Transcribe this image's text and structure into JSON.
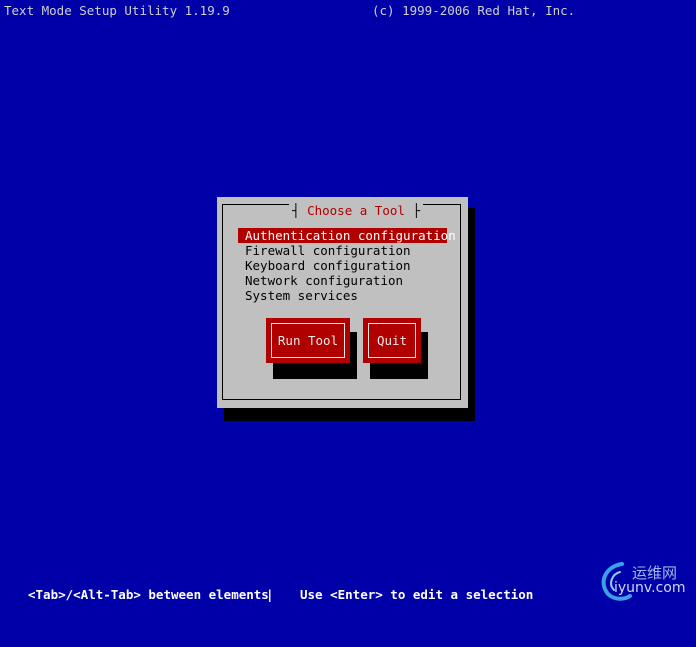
{
  "header": {
    "app_title": "Text Mode Setup Utility 1.19.9",
    "copyright": "(c) 1999-2006 Red Hat, Inc."
  },
  "dialog": {
    "title": "Choose a Tool",
    "items": [
      {
        "label": "Authentication configuration",
        "selected": true
      },
      {
        "label": "Firewall configuration",
        "selected": false
      },
      {
        "label": "Keyboard configuration",
        "selected": false
      },
      {
        "label": "Network configuration",
        "selected": false
      },
      {
        "label": "System services",
        "selected": false
      }
    ],
    "buttons": {
      "run_tool": "Run Tool",
      "quit": "Quit"
    }
  },
  "footer": {
    "hint_left": "<Tab>/<Alt-Tab> between elements",
    "separator": "|",
    "hint_right": "Use <Enter> to edit a selection"
  },
  "watermark": {
    "line1": "运维网",
    "line2": "iyunv.com"
  },
  "colors": {
    "background": "#0000a8",
    "dialog": "#c0c0c0",
    "accent": "#b00000"
  }
}
